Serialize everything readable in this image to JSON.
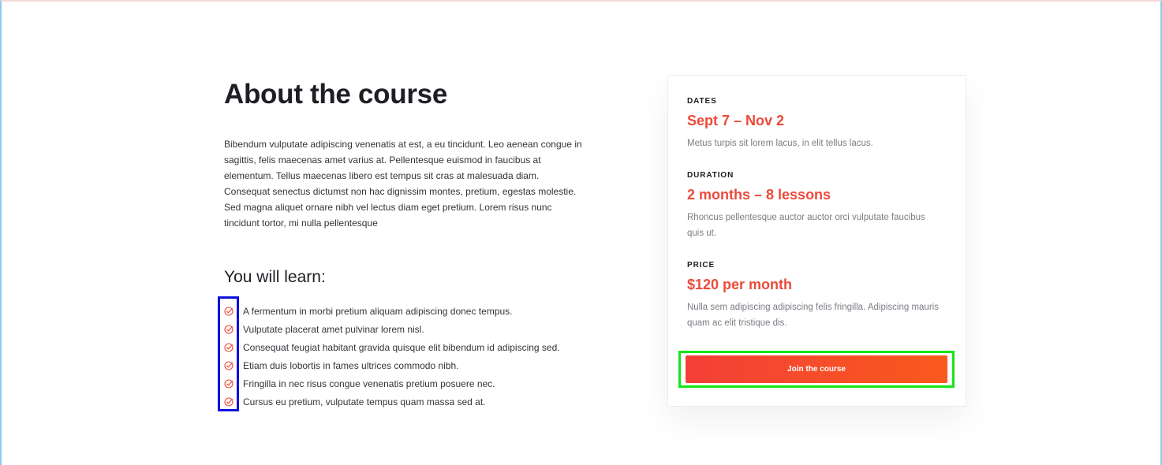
{
  "about": {
    "title": "About the course",
    "body": "Bibendum vulputate adipiscing venenatis at est, a eu tincidunt. Leo aenean congue in sagittis, felis maecenas amet varius at. Pellentesque euismod in faucibus at elementum. Tellus maecenas libero est tempus sit cras at malesuada diam. Consequat senectus dictumst non hac dignissim montes, pretium, egestas molestie. Sed magna aliquet ornare nibh vel lectus diam eget pretium. Lorem risus nunc tincidunt tortor, mi nulla pellentesque"
  },
  "learn": {
    "title": "You will learn:",
    "icon": "check-circle-icon",
    "items": [
      "A fermentum in morbi pretium aliquam adipiscing donec tempus.",
      "Vulputate placerat amet pulvinar lorem nisl.",
      "Consequat feugiat habitant gravida quisque elit bibendum id adipiscing sed.",
      "Etiam duis lobortis in fames ultrices commodo nibh.",
      "Fringilla in nec risus congue venenatis pretium posuere nec.",
      "Cursus eu pretium, vulputate tempus quam massa sed at."
    ]
  },
  "card": {
    "dates": {
      "label": "DATES",
      "value": "Sept 7 – Nov 2",
      "desc": "Metus turpis sit lorem lacus, in elit tellus lacus."
    },
    "duration": {
      "label": "DURATION",
      "value": "2 months – 8 lessons",
      "desc": "Rhoncus pellentesque auctor auctor orci vulputate faucibus quis ut."
    },
    "price": {
      "label": "PRICE",
      "value": "$120 per month",
      "desc": "Nulla sem adipiscing adipiscing felis fringilla. Adipiscing mauris quam ac elit tristique dis."
    },
    "cta_label": "Join the course"
  },
  "colors": {
    "accent": "#ec4a3a",
    "button_start": "#f33f37",
    "button_end": "#f95a1d",
    "highlight_icons": "#1010e0",
    "highlight_button": "#16e616"
  }
}
